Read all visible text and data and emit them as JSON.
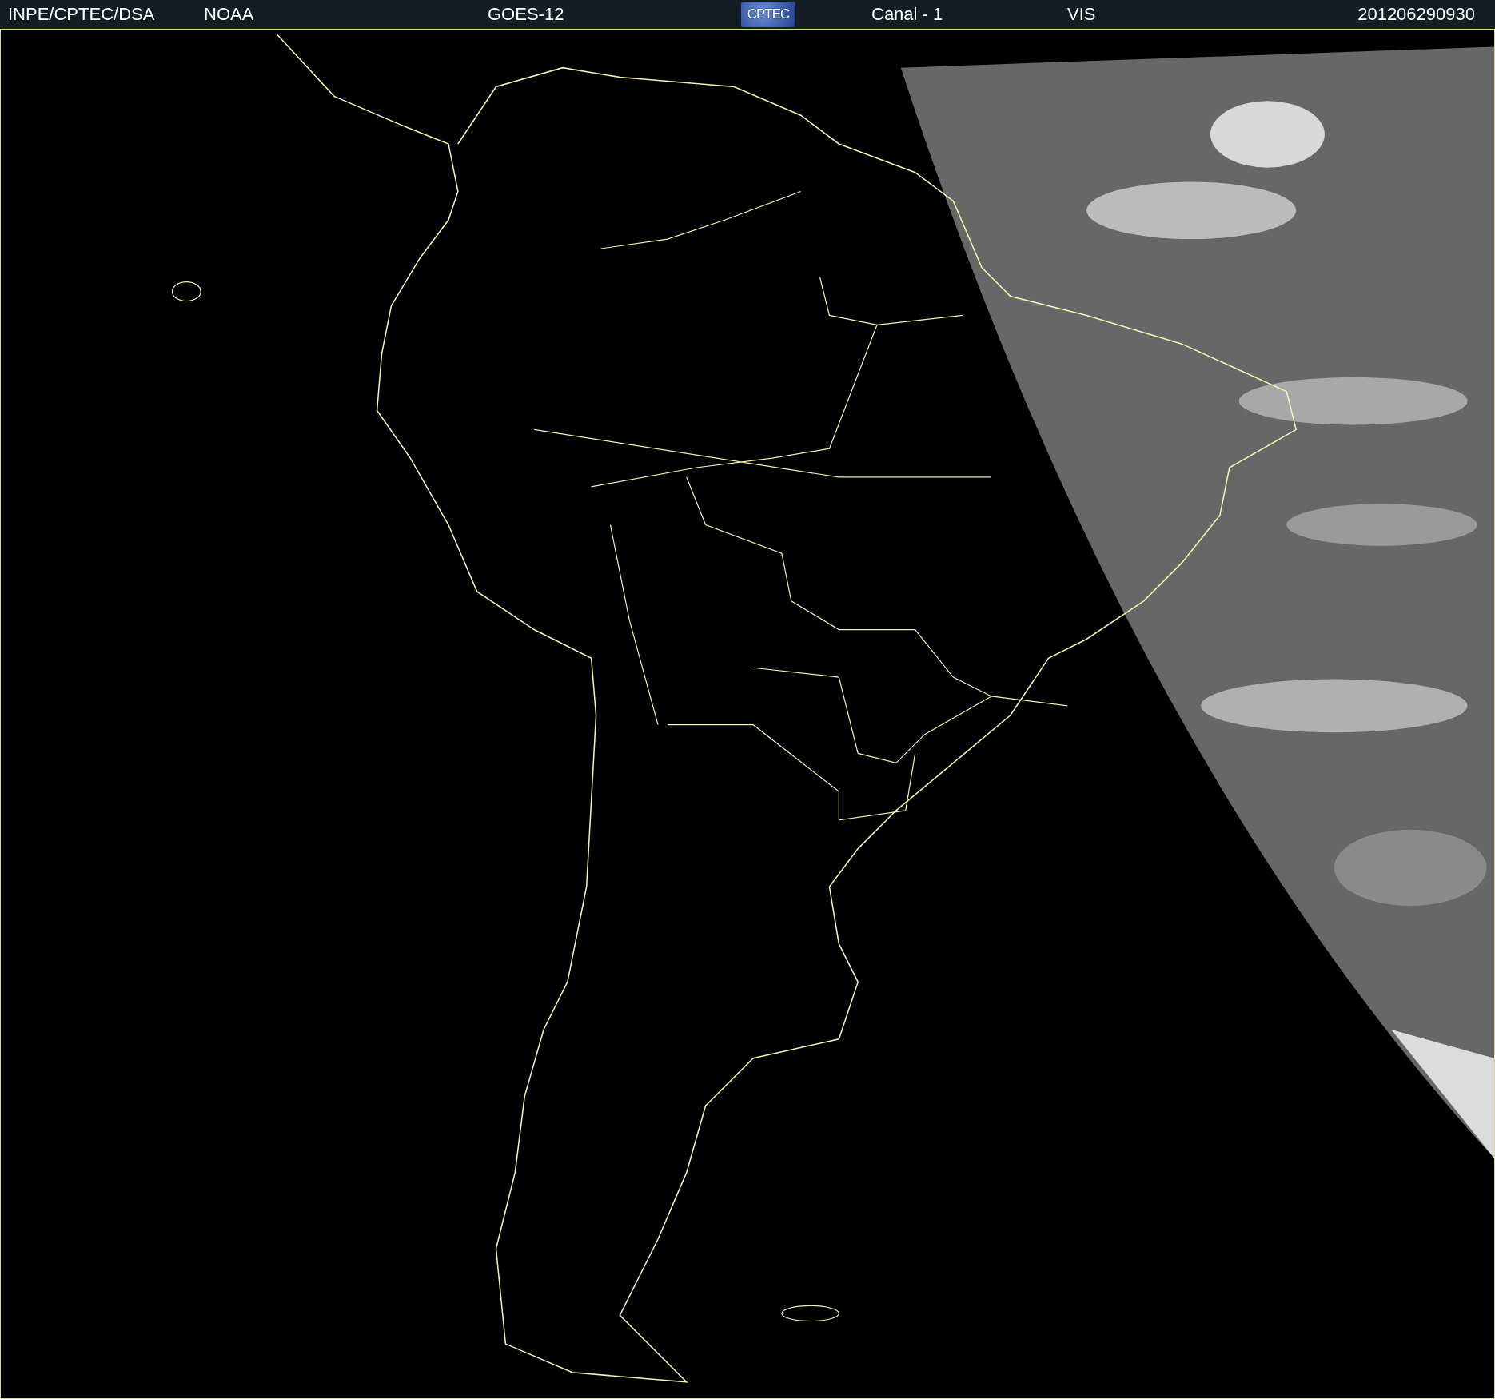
{
  "header": {
    "items": [
      {
        "kind": "text",
        "text": "INPE/CPTEC/DSA"
      },
      {
        "kind": "text",
        "text": "NOAA"
      },
      {
        "kind": "text",
        "text": "GOES-12"
      },
      {
        "kind": "logo",
        "text": "CPTEC"
      },
      {
        "kind": "text",
        "text": "Canal - 1"
      },
      {
        "kind": "text",
        "text": "VIS"
      },
      {
        "kind": "text",
        "text": "201206290930"
      }
    ]
  }
}
